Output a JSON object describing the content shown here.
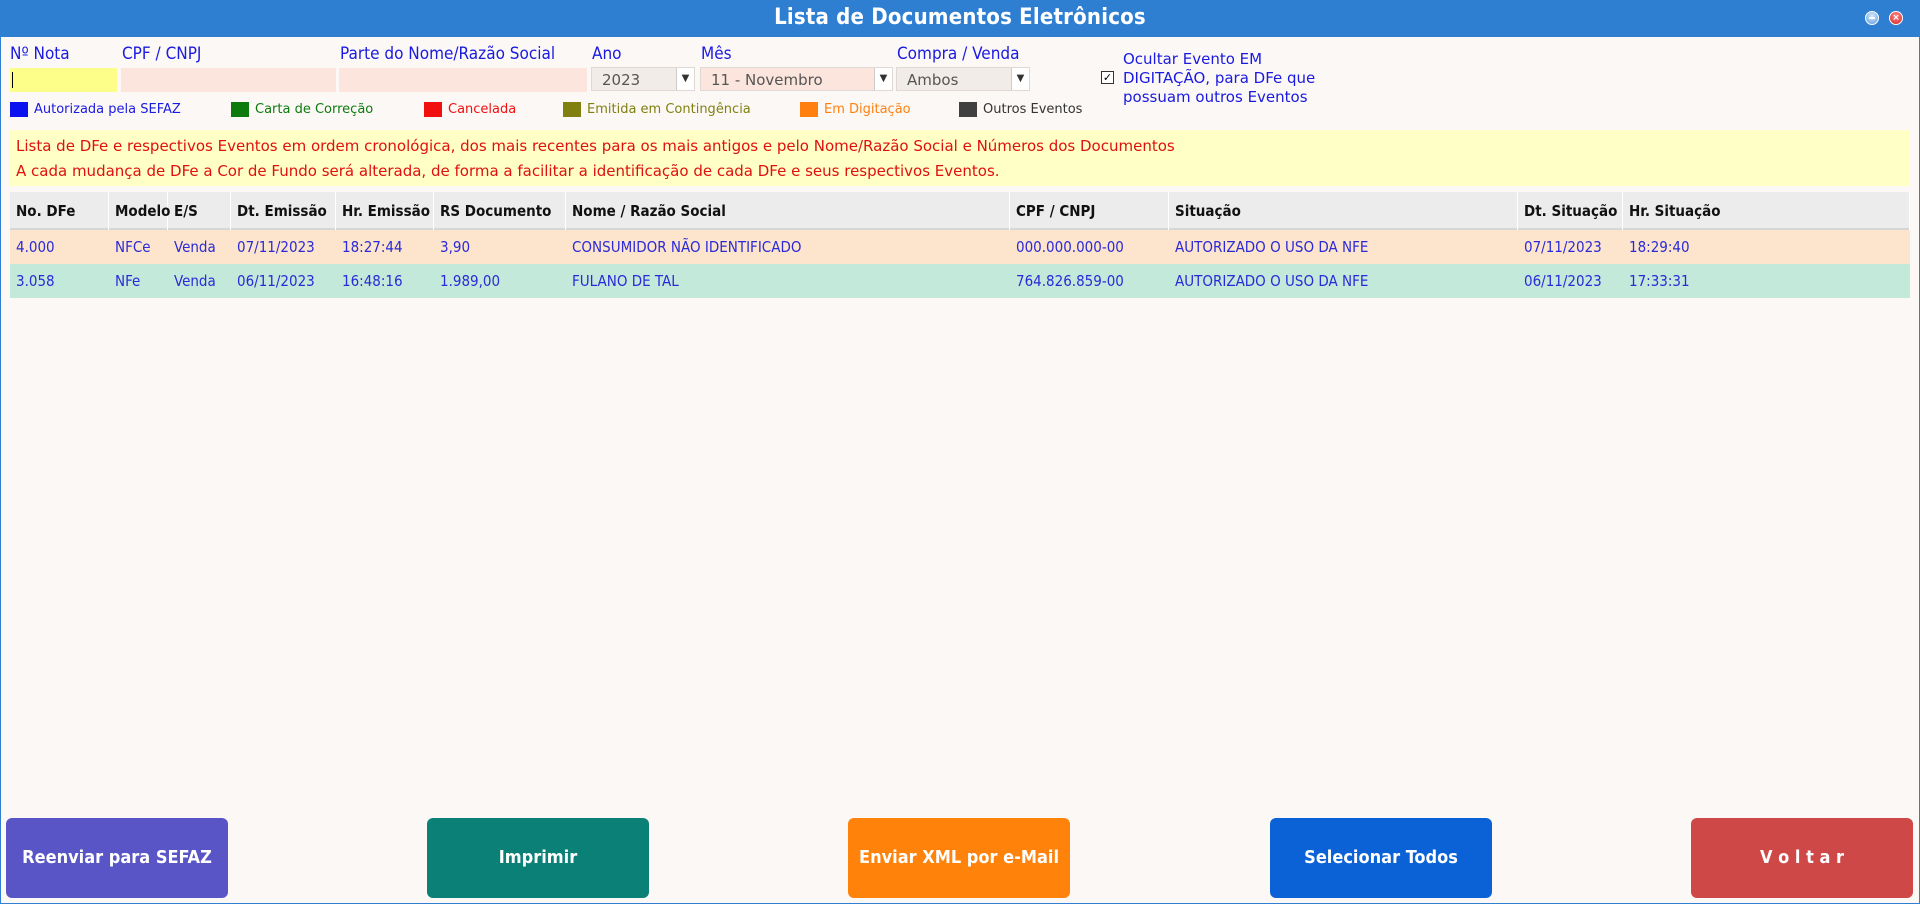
{
  "window": {
    "title": "Lista de Documentos Eletrônicos"
  },
  "filters": {
    "nota_label": "Nº Nota",
    "nota_value": "",
    "cpf_label": "CPF / CNPJ",
    "cpf_value": "",
    "nome_label": "Parte do Nome/Razão Social",
    "nome_value": "",
    "ano_label": "Ano",
    "ano_value": "2023",
    "mes_label": "Mês",
    "mes_value": "11 - Novembro",
    "tipo_label": "Compra / Venda",
    "tipo_value": "Ambos",
    "ocultar_label": "Ocultar Evento EM DIGITAÇÃO, para DFe que possuam outros Eventos",
    "ocultar_checked": true
  },
  "legend": [
    {
      "label": "Autorizada pela SEFAZ",
      "color": "#0a12f0",
      "text_color": "#1a1ae0"
    },
    {
      "label": "Carta de Correção",
      "color": "#0d7a0d",
      "text_color": "#0d7a0d"
    },
    {
      "label": "Cancelada",
      "color": "#f01010",
      "text_color": "#f01010"
    },
    {
      "label": "Emitida em Contingência",
      "color": "#808010",
      "text_color": "#808010"
    },
    {
      "label": "Em Digitação",
      "color": "#ff8010",
      "text_color": "#ff8010"
    },
    {
      "label": "Outros Eventos",
      "color": "#404040",
      "text_color": "#333333"
    }
  ],
  "notice": {
    "line1": "Lista de DFe e respectivos Eventos em ordem cronológica, dos mais recentes para os mais antigos e pelo Nome/Razão Social e Números dos Documentos",
    "line2": "A cada mudança de DFe a Cor de Fundo será alterada, de forma a facilitar a identificação de cada DFe e seus respectivos Eventos."
  },
  "table": {
    "columns": [
      "No. DFe",
      "Modelo",
      "E/S",
      "Dt. Emissão",
      "Hr. Emissão",
      "RS Documento",
      "Nome / Razão Social",
      "CPF / CNPJ",
      "Situação",
      "Dt. Situação",
      "Hr. Situação"
    ],
    "rows": [
      [
        "4.000",
        "NFCe",
        "Venda",
        "07/11/2023",
        "18:27:44",
        "3,90",
        "CONSUMIDOR NÃO IDENTIFICADO",
        "000.000.000-00",
        "AUTORIZADO O USO DA NFE",
        "07/11/2023",
        "18:29:40"
      ],
      [
        "3.058",
        "NFe",
        "Venda",
        "06/11/2023",
        "16:48:16",
        "1.989,00",
        "FULANO DE TAL",
        "764.826.859-00",
        "AUTORIZADO O USO DA NFE",
        "06/11/2023",
        "17:33:31"
      ]
    ]
  },
  "buttons": {
    "reenviar": "Reenviar para SEFAZ",
    "imprimir": "Imprimir",
    "enviar_xml": "Enviar XML por e-Mail",
    "selecionar": "Selecionar Todos",
    "voltar": "V o l t a r"
  },
  "colors": {
    "titlebar": "#2e7fd2",
    "btn_reenviar": "#5a55c6",
    "btn_imprimir": "#0a8076",
    "btn_enviar": "#ff820a",
    "btn_selecionar": "#0a62d6",
    "btn_voltar": "#cf4848"
  }
}
